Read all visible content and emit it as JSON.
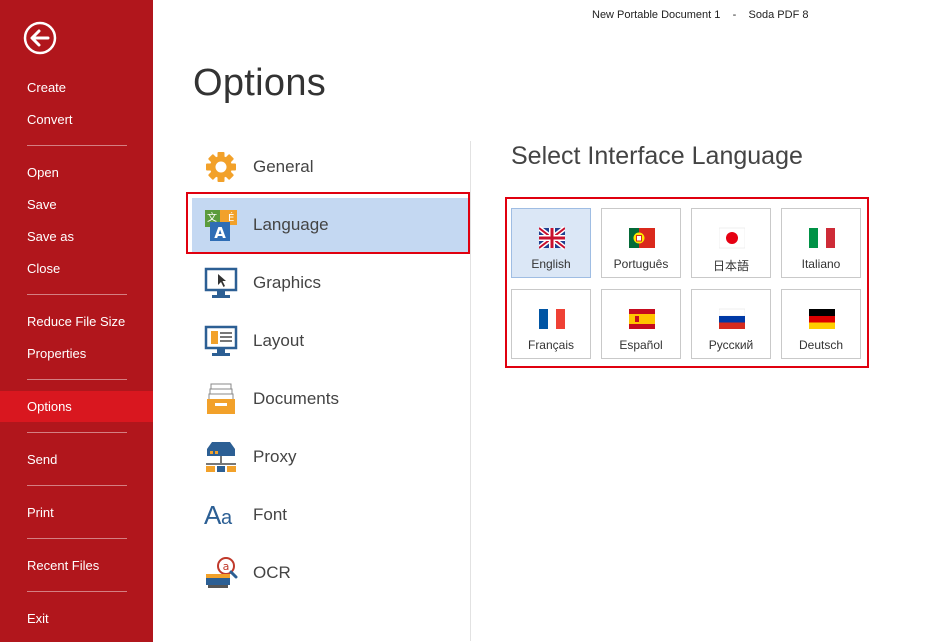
{
  "window": {
    "document_name": "New Portable Document 1",
    "separator": "-",
    "app_name": "Soda PDF 8"
  },
  "sidebar": {
    "items": [
      {
        "label": "Create"
      },
      {
        "label": "Convert"
      },
      {
        "label": "Open"
      },
      {
        "label": "Save"
      },
      {
        "label": "Save as"
      },
      {
        "label": "Close"
      },
      {
        "label": "Reduce File Size"
      },
      {
        "label": "Properties"
      },
      {
        "label": "Options",
        "active": true
      },
      {
        "label": "Send"
      },
      {
        "label": "Print"
      },
      {
        "label": "Recent Files"
      },
      {
        "label": "Exit"
      }
    ]
  },
  "page": {
    "title": "Options"
  },
  "options_menu": {
    "items": [
      {
        "label": "General",
        "icon": "gear-icon"
      },
      {
        "label": "Language",
        "icon": "language-icon",
        "active": true
      },
      {
        "label": "Graphics",
        "icon": "monitor-cursor-icon"
      },
      {
        "label": "Layout",
        "icon": "layout-icon"
      },
      {
        "label": "Documents",
        "icon": "documents-tray-icon"
      },
      {
        "label": "Proxy",
        "icon": "proxy-network-icon"
      },
      {
        "label": "Font",
        "icon": "font-aa-icon"
      },
      {
        "label": "OCR",
        "icon": "ocr-scanner-icon"
      }
    ]
  },
  "language_panel": {
    "title": "Select Interface Language",
    "languages": [
      {
        "label": "English",
        "flag": "uk-flag-icon",
        "selected": true
      },
      {
        "label": "Português",
        "flag": "portugal-flag-icon"
      },
      {
        "label": "日本語",
        "flag": "japan-flag-icon"
      },
      {
        "label": "Italiano",
        "flag": "italy-flag-icon"
      },
      {
        "label": "Français",
        "flag": "france-flag-icon"
      },
      {
        "label": "Español",
        "flag": "spain-flag-icon"
      },
      {
        "label": "Русский",
        "flag": "russia-flag-icon"
      },
      {
        "label": "Deutsch",
        "flag": "germany-flag-icon"
      }
    ]
  },
  "colors": {
    "sidebar": "#b1161c",
    "sidebar_active": "#d9171f",
    "highlight": "#e0000f",
    "selection": "#c4d8f2"
  }
}
